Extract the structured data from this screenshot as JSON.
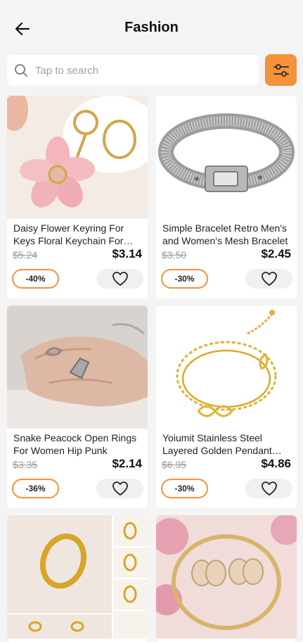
{
  "header": {
    "title": "Fashion"
  },
  "search": {
    "placeholder": "Tap to search"
  },
  "products": [
    {
      "name": "Daisy Flower Keyring For Keys Floral Keychain For Women",
      "old_price": "$5.24",
      "price": "$3.14",
      "discount": "-40%"
    },
    {
      "name": "Simple Bracelet Retro Men's and Women's Mesh Bracelet",
      "old_price": "$3.50",
      "price": "$2.45",
      "discount": "-30%"
    },
    {
      "name": "Snake Peacock Open Rings For Women Hip Punk",
      "old_price": "$3.35",
      "price": "$2.14",
      "discount": "-36%"
    },
    {
      "name": "Yoiumit Stainless Steel Layered Golden Pendant Bracelet",
      "old_price": "$6.95",
      "price": "$4.86",
      "discount": "-30%"
    }
  ],
  "colors": {
    "accent": "#f5923a",
    "background": "#f4f4f4",
    "card": "#ffffff"
  }
}
